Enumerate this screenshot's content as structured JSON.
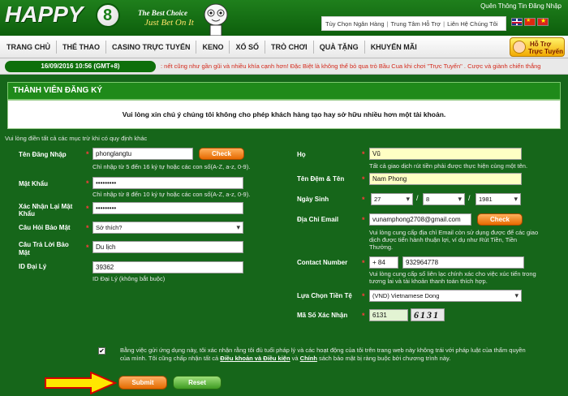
{
  "header": {
    "logo_text": "HAPPY",
    "logo_digit": "8",
    "slogan_line1": "The Best Choice",
    "slogan_line2": "Just Bet On It",
    "account_link": "Quên Thông Tin Đăng Nhập",
    "top_links": [
      "Tùy Chọn Ngân Hàng",
      "Trung Tâm Hỗ Trợ",
      "Liên Hệ Chúng Tôi"
    ],
    "support_button": {
      "line1": "Hỗ Trợ",
      "line2": "Trực Tuyến"
    }
  },
  "nav": {
    "items": [
      "TRANG CHỦ",
      "THỂ THAO",
      "CASINO TRỰC TUYẾN",
      "KENO",
      "XỔ SỐ",
      "TRÒ CHƠI",
      "QUÀ TẶNG",
      "KHUYẾN MÃI"
    ]
  },
  "ticker": {
    "datetime": "16/09/2016  10:56 (GMT+8)",
    "text": ": nết cũng như gần gũi và nhiều khía cạnh hơn! Đặc Biệt là không thể bỏ qua trò Bầu Cua khi chơi \"Trực Tuyến\" . Cược và giành chiến thắng"
  },
  "form": {
    "title": "THÀNH VIÊN ĐĂNG KÝ",
    "warning": "Vui lòng xin chú ý chúng tôi không cho phép khách hàng tạo hay sở hữu nhiều hơn một tài khoản.",
    "hint": "Vui lòng điền tất cả các mục trừ khi có quy định khác",
    "left": {
      "username": {
        "label": "Tên Đăng Nhập",
        "value": "phonglangtu",
        "check": "Check",
        "note": "Chỉ nhập từ 5 đến 16 ký tự hoặc các con số(A-Z, a-z, 0-9)."
      },
      "password": {
        "label": "Mật Khẩu",
        "value": "•••••••••",
        "note": "Chỉ nhập từ 8 đến 10 ký tự hoặc các con số(A-Z, a-z, 0-9)."
      },
      "confirm": {
        "label_line1": "Xác Nhận Lại Mật",
        "label_line2": "Khẩu",
        "value": "•••••••••"
      },
      "question": {
        "label": "Câu Hỏi Bảo Mật",
        "value": "Sở thích?"
      },
      "answer": {
        "label_line1": "Câu Trả Lời Bảo",
        "label_line2": "Mật",
        "value": "Du lịch"
      },
      "agent": {
        "label": "ID Đại Lý",
        "value": "39362",
        "note": "ID Đại Lý (không bắt buộc)"
      }
    },
    "right": {
      "lastname": {
        "label": "Họ",
        "value": "Vũ",
        "note": "Tất cả giao dịch rút tiền phải được thực hiện cùng một tên."
      },
      "firstname": {
        "label": "Tên Đệm & Tên",
        "value": "Nam Phong"
      },
      "dob": {
        "label": "Ngày Sinh",
        "day": "27",
        "month": "8",
        "year": "1981"
      },
      "email": {
        "label": "Địa Chỉ Email",
        "value": "vunamphong2708@gmail.com",
        "check": "Check",
        "note_lines": [
          "Vui lòng cung cấp địa chỉ Email còn sử dụng được để các giao",
          "dịch được tiến hành thuận lợi, ví dụ như Rút Tiền, Tiền",
          "Thưởng."
        ]
      },
      "phone": {
        "label": "Contact Number",
        "code": "+ 84",
        "value": "932964778",
        "note_lines": [
          "Vui lòng cung cấp số liên lạc chính xác cho việc xúc tiến trong",
          "tương lai và tài khoản thanh toán thích hợp."
        ]
      },
      "currency": {
        "label": "Lựa Chọn Tiền Tệ",
        "value": "(VND) Vietnamese Dong"
      },
      "captcha": {
        "label": "Mã Số Xác Nhận",
        "value": "6131",
        "image_text": "6131"
      }
    },
    "agreement": {
      "checked": "✔",
      "line1": "Bằng việc gửi ứng dụng này, tôi xác nhận rằng tôi đủ tuổi pháp lý và các hoạt động của tôi trên trang web này không trái với pháp luật của thẩm quyền",
      "line2_pre": "của mình. Tôi cũng chấp nhận tất cả ",
      "terms": "Điều khoản và Điều kiện",
      "and": " và ",
      "policy": "Chính",
      "line2_post": " sách bảo mật bị ràng buộc bởi chương trình này."
    },
    "buttons": {
      "submit": "Submit",
      "reset": "Reset"
    }
  }
}
